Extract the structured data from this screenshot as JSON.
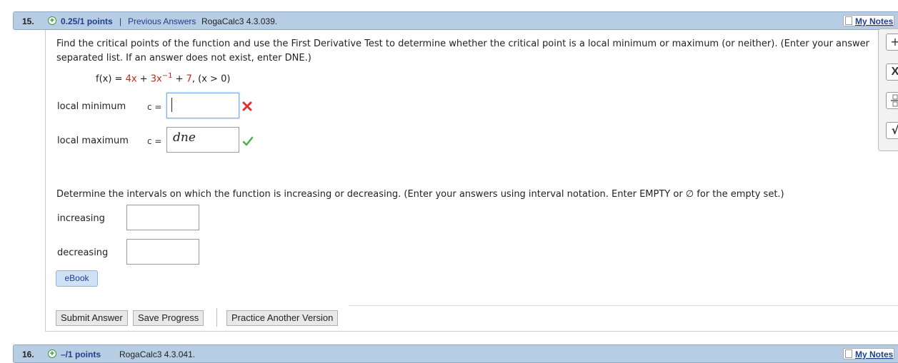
{
  "q15": {
    "number": "15.",
    "points": "0.25/1 points",
    "separator": "|",
    "previous_answers": "Previous Answers",
    "code": "RogaCalc3 4.3.039.",
    "my_notes": "My Notes"
  },
  "problem": {
    "intro_line1": "Find the critical points of the function and use the First Derivative Test to determine whether the critical point is a local minimum or maximum (or neither). (Enter your answer",
    "intro_line2": "separated list. If an answer does not exist, enter DNE.)",
    "function": {
      "fx": "f(x) = ",
      "term1": "4x",
      "plus1": " + ",
      "term2": "3x",
      "exp": "−1",
      "plus2": " + ",
      "term3": "7",
      "domain": ", (x > 0)"
    },
    "local_min_label": "local minimum",
    "local_min_ceq": "c =",
    "local_min_value": "",
    "local_max_label": "local maximum",
    "local_max_ceq": "c =",
    "local_max_value": "dne",
    "intervals_prompt": "Determine the intervals on which the function is increasing or decreasing. (Enter your answers using interval notation. Enter EMPTY or ∅ for the empty set.)",
    "increasing_label": "increasing",
    "increasing_value": "",
    "decreasing_label": "decreasing",
    "decreasing_value": ""
  },
  "buttons": {
    "ebook": "eBook",
    "submit": "Submit Answer",
    "save": "Save Progress",
    "practice": "Practice Another Version"
  },
  "toolbar": {
    "plus": "+",
    "x": "X",
    "sqrt": "√"
  },
  "q16": {
    "number": "16.",
    "points": "–/1 points",
    "code": "RogaCalc3 4.3.041.",
    "my_notes": "My Notes"
  },
  "colors": {
    "header_bar": "#b6cde3",
    "link": "#1f3f8f",
    "red": "#cc2222",
    "green_check": "#4caf50"
  }
}
